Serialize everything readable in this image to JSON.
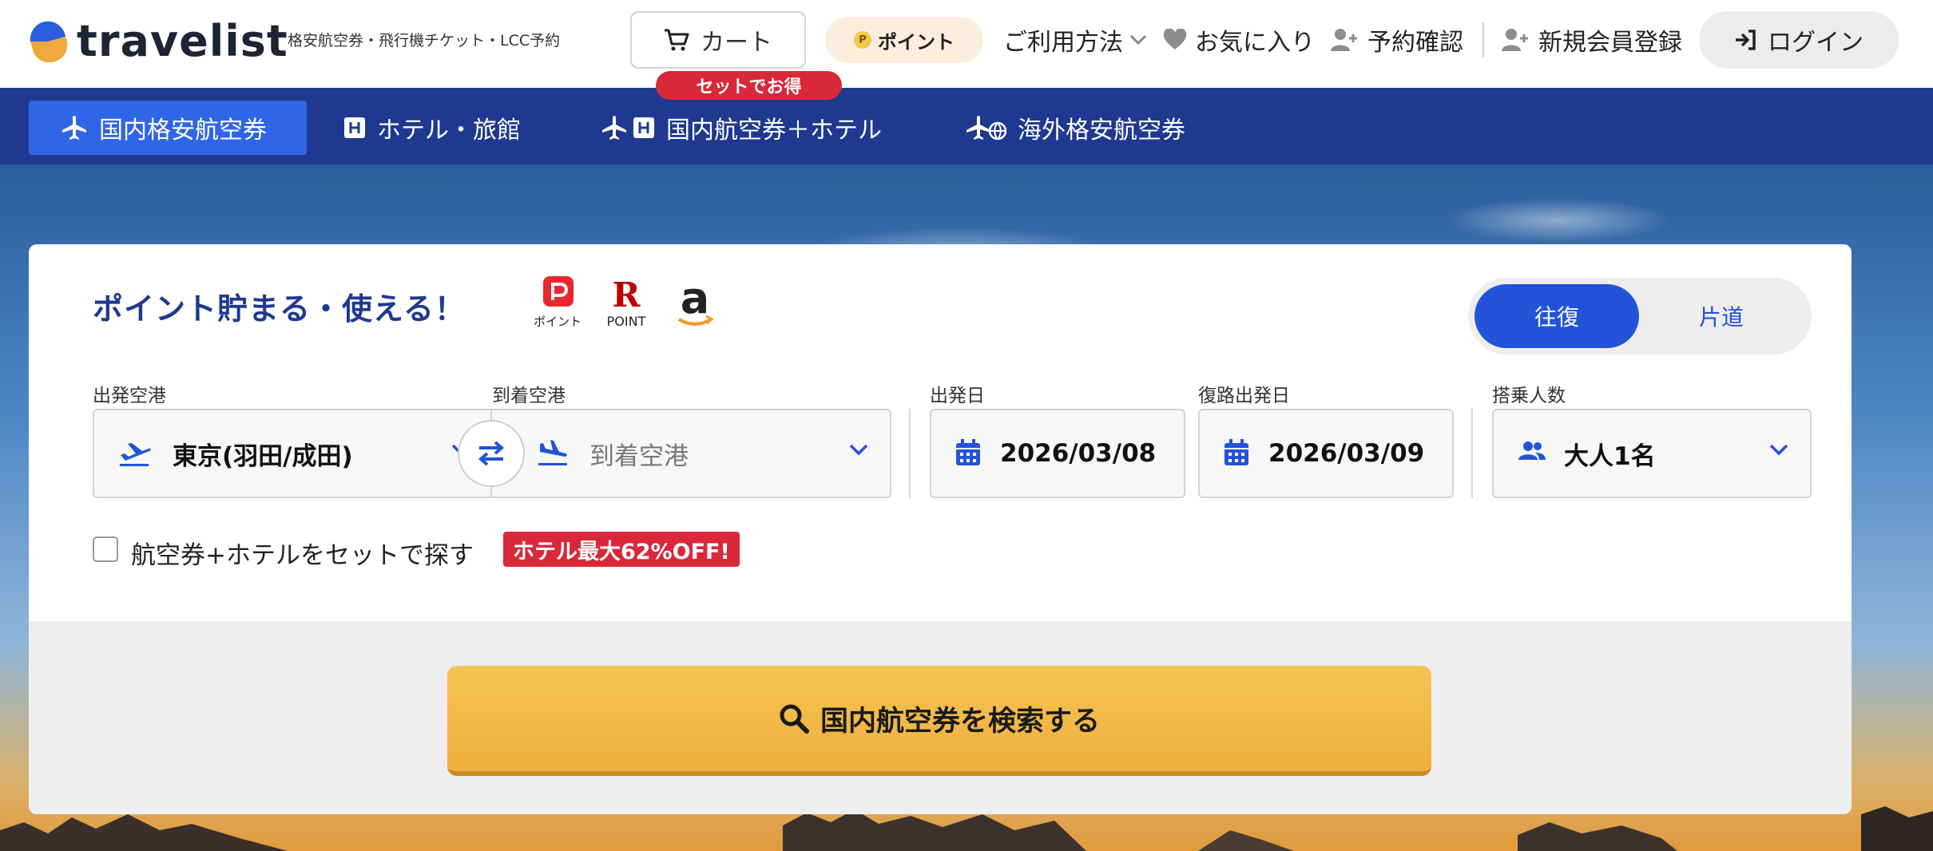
{
  "header": {
    "logo_text": "travelist",
    "tagline": "格安航空券・飛行機チケット・LCC予約",
    "cart_label": "カート",
    "cart_badge": "セットでお得",
    "point_label": "ポイント",
    "point_coin": "P",
    "nav": {
      "usage": "ご利用方法",
      "favorites": "お気に入り",
      "reservation": "予約確認",
      "register": "新規会員登録"
    },
    "login_label": "ログイン"
  },
  "tabs": [
    {
      "label": "国内格安航空券",
      "active": true
    },
    {
      "label": "ホテル・旅館",
      "active": false
    },
    {
      "label": "国内航空券＋ホテル",
      "active": false
    },
    {
      "label": "海外格安航空券",
      "active": false
    }
  ],
  "search": {
    "promo_title": "ポイント貯まる・使える！",
    "partner_logos": {
      "paypay_text": "ポイント",
      "rakuten_letter": "R",
      "rakuten_text": "POINT",
      "amazon_letter": "a"
    },
    "trip_type": {
      "round_trip": "往復",
      "one_way": "片道",
      "selected": "往復"
    },
    "departure": {
      "label": "出発空港",
      "value": "東京(羽田/成田)"
    },
    "arrival": {
      "label": "到着空港",
      "placeholder": "到着空港"
    },
    "depart_date": {
      "label": "出発日",
      "value": "2026/03/08"
    },
    "return_date": {
      "label": "復路出発日",
      "value": "2026/03/09"
    },
    "passengers": {
      "label": "搭乗人数",
      "value": "大人1名"
    },
    "hotel_set_label": "航空券+ホテルをセットで探す",
    "hotel_set_badge": "ホテル最大62%OFF!",
    "hotel_set_checked": false,
    "submit_label": "国内航空券を検索する"
  },
  "colors": {
    "brand_navy": "#1f3990",
    "tab_active": "#2f66e8",
    "toggle_blue": "#2253d9",
    "badge_red": "#d9283a",
    "search_yellow": "#efae3d"
  }
}
